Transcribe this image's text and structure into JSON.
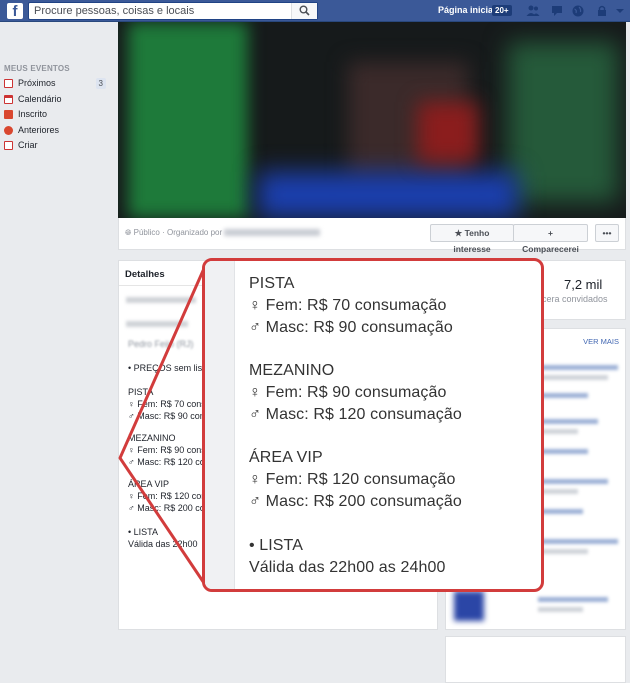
{
  "topbar": {
    "search_placeholder": "Procure pessoas, coisas e locais",
    "home_label": "Página inicial",
    "home_badge": "20+"
  },
  "left_nav": {
    "heading": "MEUS EVENTOS",
    "items": [
      {
        "label": "Próximos",
        "count": "3",
        "icon": "calendar-upcoming-icon"
      },
      {
        "label": "Calendário",
        "icon": "calendar-icon"
      },
      {
        "label": "Inscrito",
        "icon": "rss-icon"
      },
      {
        "label": "Anteriores",
        "icon": "history-icon"
      },
      {
        "label": "Criar",
        "icon": "add-event-icon"
      }
    ]
  },
  "event_bar": {
    "privacy_text": "Público · Organizado por",
    "interest_button": "Tenho interesse",
    "attend_button": "Comparecerei",
    "more_button": "•••"
  },
  "details": {
    "title": "Detalhes",
    "lines": [
      "Pedro Feijó (RJ)",
      "• PREÇOS sem lis",
      "PISTA",
      "♀ Fem: R$ 70 cons",
      "♂ Masc: R$ 90 cons",
      "MEZANINO",
      "♀ Fem: R$ 90 cons",
      "♂ Masc: R$ 120 cons",
      "ÁREA VIP",
      "♀ Fem: R$ 120 cons",
      "♂ Masc: R$ 200 cons",
      "• LISTA",
      "Válida das 22h00"
    ]
  },
  "stats": {
    "count": "7,2 mil",
    "label": "cera convidados"
  },
  "right_card": {
    "heading": "OS",
    "see_more": "VER MAIS"
  },
  "zoom": {
    "lines": [
      "PISTA",
      "♀ Fem: R$ 70 consumação",
      "♂ Masc: R$ 90 consumação",
      "MEZANINO",
      "♀ Fem: R$ 90 consumação",
      "♂ Masc: R$ 120 consumação",
      "ÁREA VIP",
      "♀ Fem: R$ 120 consumação",
      "♂ Masc: R$ 200 consumação",
      "• LISTA",
      "Válida das 22h00 as 24h00"
    ]
  },
  "colors": {
    "brand": "#3b5998",
    "callout_border": "#d23c3c",
    "page_bg": "#e9ebee"
  }
}
